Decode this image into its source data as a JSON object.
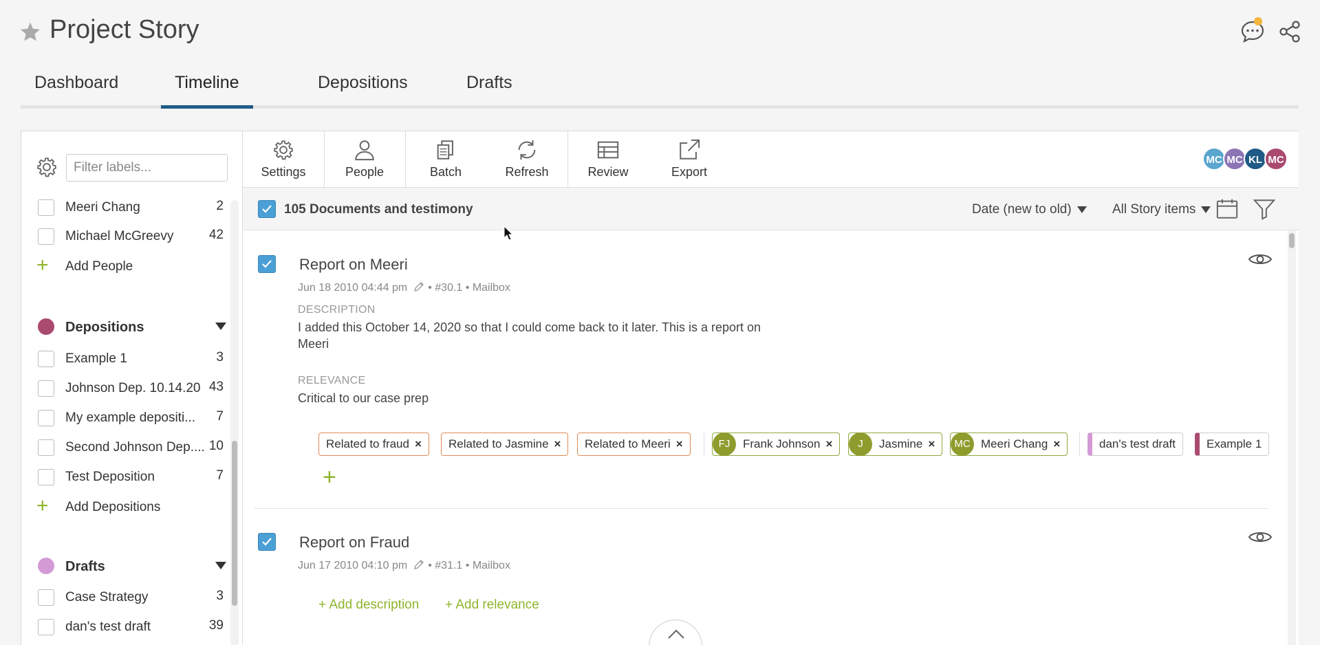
{
  "header": {
    "title": "Project Story"
  },
  "tabs": [
    {
      "label": "Dashboard"
    },
    {
      "label": "Timeline"
    },
    {
      "label": "Depositions"
    },
    {
      "label": "Drafts"
    }
  ],
  "sidebar": {
    "filter_placeholder": "Filter labels...",
    "people": [
      {
        "label": "Meeri Chang",
        "count": "2"
      },
      {
        "label": "Michael McGreevy",
        "count": "42"
      }
    ],
    "add_people": "Add People",
    "depositions_section": {
      "label": "Depositions",
      "color": "#a94a6e"
    },
    "depositions": [
      {
        "label": "Example 1",
        "count": "3"
      },
      {
        "label": "Johnson Dep. 10.14.20",
        "count": "43"
      },
      {
        "label": "My example depositi...",
        "count": "7"
      },
      {
        "label": "Second Johnson Dep....",
        "count": "10"
      },
      {
        "label": "Test Deposition",
        "count": "7"
      }
    ],
    "add_depositions": "Add Depositions",
    "drafts_section": {
      "label": "Drafts",
      "color": "#d49ad6"
    },
    "drafts": [
      {
        "label": "Case Strategy",
        "count": "3"
      },
      {
        "label": "dan's test draft",
        "count": "39"
      }
    ]
  },
  "toolbar": {
    "settings": "Settings",
    "people": "People",
    "batch": "Batch",
    "refresh": "Refresh",
    "review": "Review",
    "export": "Export",
    "avatars": [
      {
        "initials": "MC",
        "color": "#5aa6cf"
      },
      {
        "initials": "MC",
        "color": "#8c74b5"
      },
      {
        "initials": "KL",
        "color": "#1f5b86"
      },
      {
        "initials": "MC",
        "color": "#a94a6e"
      }
    ]
  },
  "list_header": {
    "count_label": "105 Documents and testimony",
    "sort_label": "Date (new to old)",
    "filter_label": "All Story items"
  },
  "items": [
    {
      "title": "Report on Meeri",
      "meta_date": "Jun 18 2010 04:44 pm",
      "meta_rest": "• #30.1 • Mailbox",
      "description_label": "DESCRIPTION",
      "description": "I added this October 14, 2020 so that I could come back to it later. This is a report on Meeri",
      "relevance_label": "RELEVANCE",
      "relevance": "Critical to our case prep",
      "issue_tags": [
        "Related to fraud",
        "Related to Jasmine",
        "Related to Meeri"
      ],
      "people_tags": [
        {
          "initials": "FJ",
          "name": "Frank Johnson"
        },
        {
          "initials": "J",
          "name": "Jasmine"
        },
        {
          "initials": "MC",
          "name": "Meeri Chang"
        }
      ],
      "draft_tag": "dan's test draft",
      "deposition_tag": "Example 1"
    },
    {
      "title": "Report on Fraud",
      "meta_date": "Jun 17 2010 04:10 pm",
      "meta_rest": "• #31.1 • Mailbox",
      "add_description": "+ Add description",
      "add_relevance": "+ Add relevance"
    }
  ],
  "colors": {
    "accent_blue": "#1f5b86",
    "check_blue": "#4a9fd5",
    "green": "#8eb52c",
    "orange_tag": "#e08a57"
  }
}
